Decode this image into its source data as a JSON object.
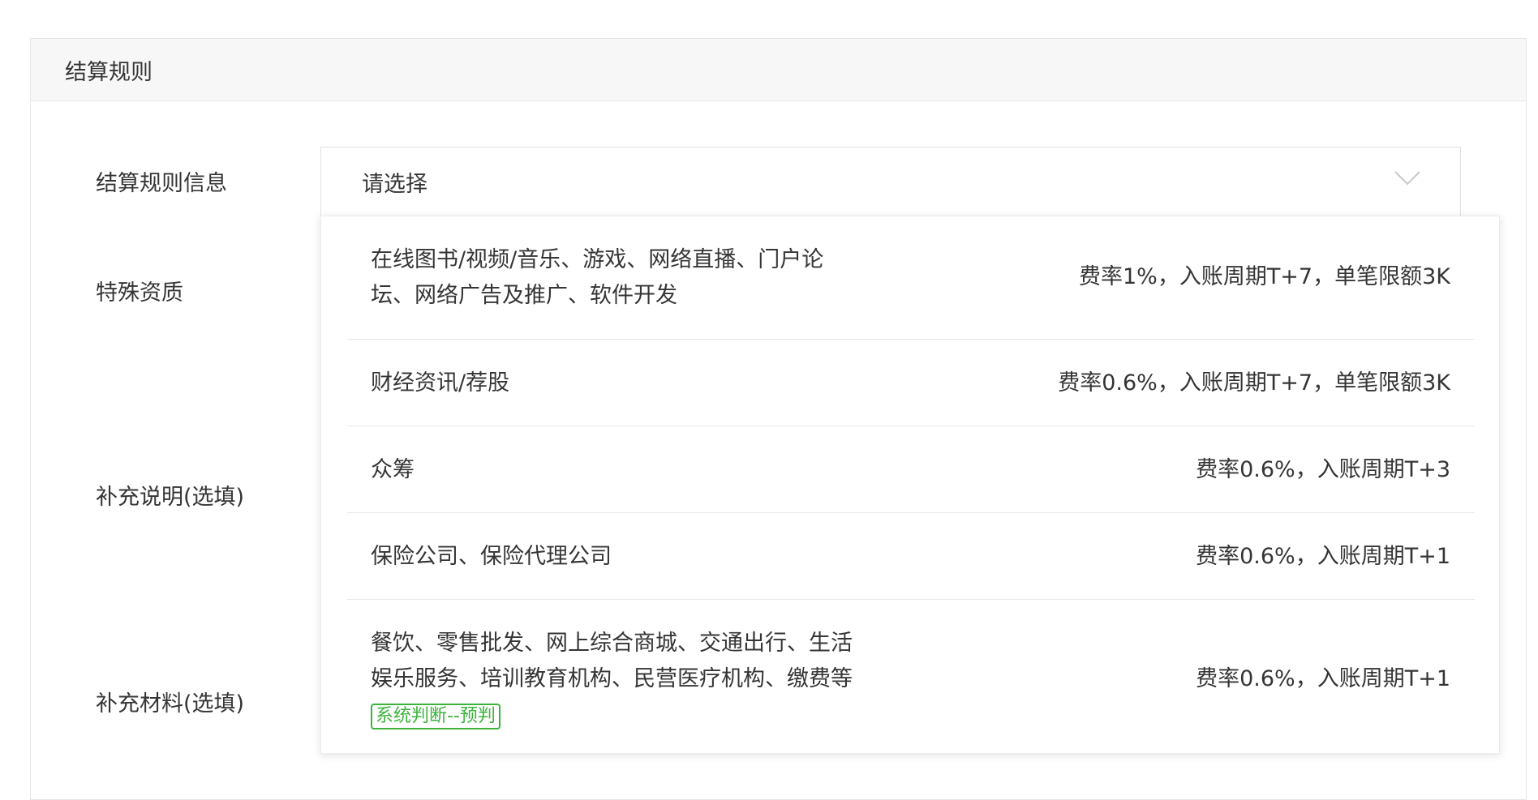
{
  "section": {
    "title": "结算规则"
  },
  "form": {
    "settlement_label": "结算规则信息",
    "special_label": "特殊资质",
    "remark_label": "补充说明(选填)",
    "material_label": "补充材料(选填)",
    "select_placeholder": "请选择"
  },
  "dropdown": {
    "options": [
      {
        "line1": "在线图书/视频/音乐、游戏、网络直播、门户论",
        "line2": "坛、网络广告及推广、软件开发",
        "rule": "费率1%，入账周期T+7，单笔限额3K"
      },
      {
        "line1": "财经资讯/荐股",
        "rule": "费率0.6%，入账周期T+7，单笔限额3K"
      },
      {
        "line1": "众筹",
        "rule": "费率0.6%，入账周期T+3"
      },
      {
        "line1": "保险公司、保险代理公司",
        "rule": "费率0.6%，入账周期T+1"
      },
      {
        "line1": "餐饮、零售批发、网上综合商城、交通出行、生活",
        "line2": "娱乐服务、培训教育机构、民营医疗机构、缴费等",
        "tag": "系统判断--预判",
        "rule": "费率0.6%，入账周期T+1"
      }
    ]
  },
  "colors": {
    "tag_green": "#3bb33b",
    "header_bg": "#f7f7f7"
  }
}
